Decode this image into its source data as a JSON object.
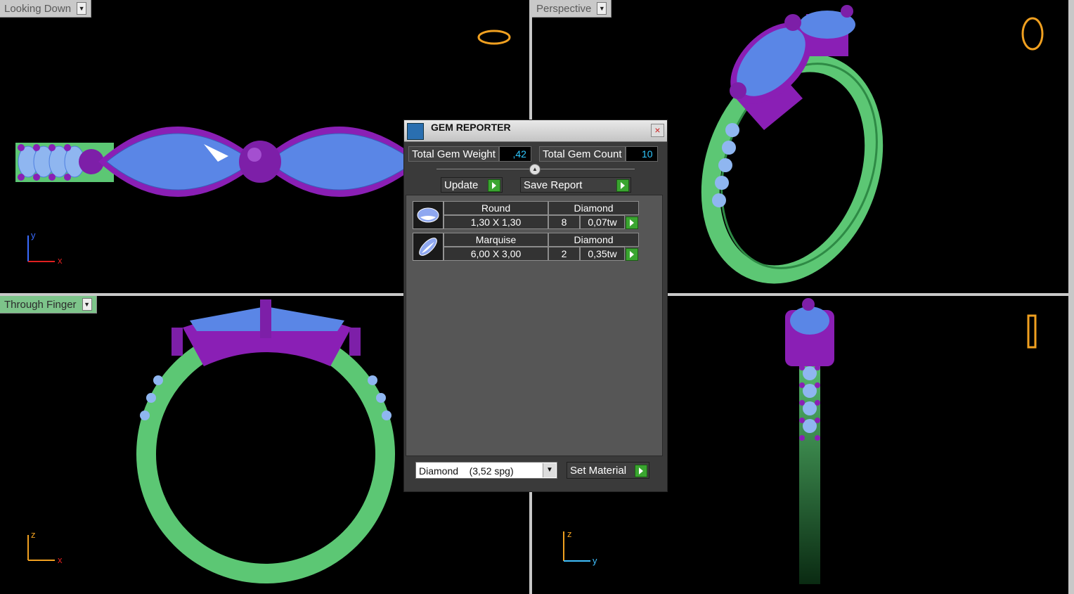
{
  "viewports": {
    "top_left": {
      "label": "Looking Down",
      "axis_v": "y",
      "axis_h": "x"
    },
    "top_right": {
      "label": "Perspective"
    },
    "bottom_left": {
      "label": "Through Finger",
      "axis_v": "z",
      "axis_h": "x"
    },
    "bottom_right": {
      "axis_v": "z",
      "axis_h": "y"
    }
  },
  "gem_reporter": {
    "title": "GEM REPORTER",
    "total_weight_label": "Total Gem Weight",
    "total_weight_value": ",42",
    "total_count_label": "Total Gem Count",
    "total_count_value": "10",
    "update_label": "Update",
    "save_report_label": "Save Report",
    "gems": [
      {
        "shape": "Round",
        "type": "Diamond",
        "size": "1,30 X 1,30",
        "count": "8",
        "weight": "0,07tw"
      },
      {
        "shape": "Marquise",
        "type": "Diamond",
        "size": "6,00 X 3,00",
        "count": "2",
        "weight": "0,35tw"
      }
    ],
    "material_select": "Diamond    (3,52 spg)",
    "set_material_label": "Set Material"
  },
  "colors": {
    "band": "#5cc774",
    "setting": "#8a1fb5",
    "gem": "#4f7fe0",
    "axis": "#ff7a00",
    "preview": "#f0a020"
  }
}
